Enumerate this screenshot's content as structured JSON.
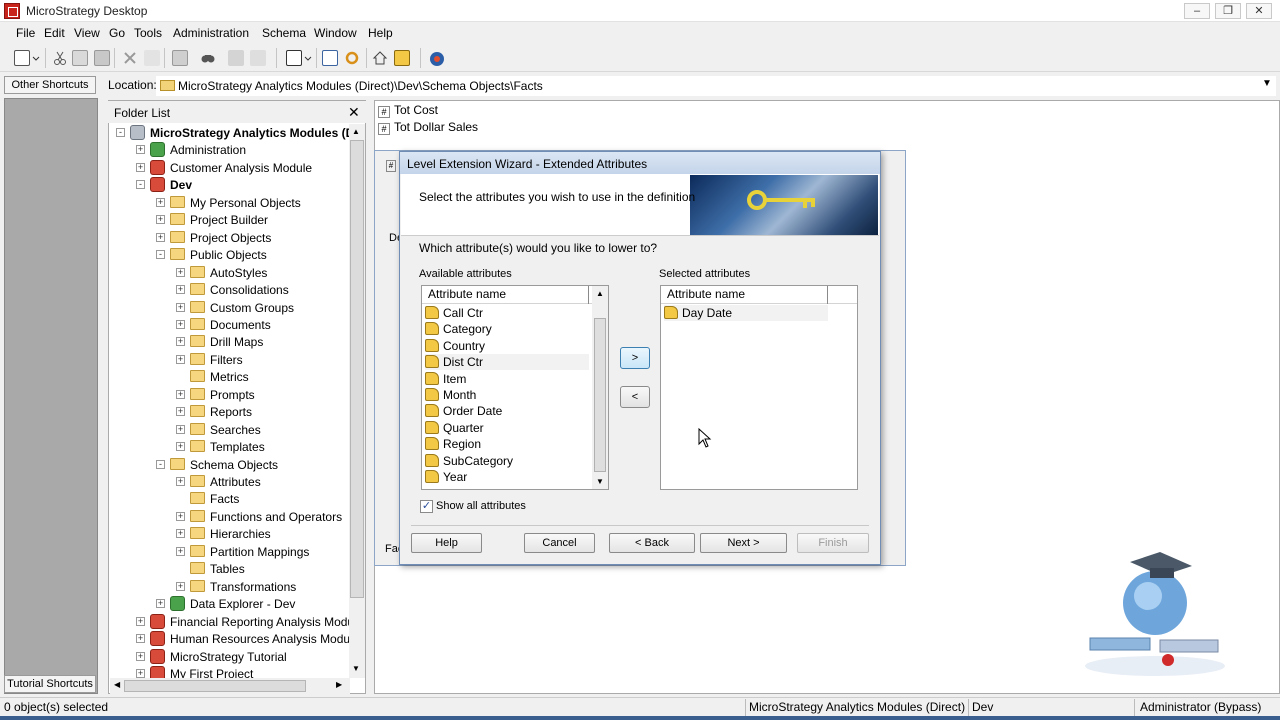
{
  "window": {
    "title": "MicroStrategy Desktop",
    "minimize": "–",
    "restore": "❐",
    "close": "✕"
  },
  "menu": {
    "file": "File",
    "edit": "Edit",
    "view": "View",
    "go": "Go",
    "tools": "Tools",
    "administration": "Administration",
    "schema": "Schema",
    "window": "Window",
    "help": "Help"
  },
  "shortcuts": {
    "other": "Other Shortcuts",
    "tutorial": "Tutorial Shortcuts"
  },
  "location": {
    "label": "Location:",
    "path": "MicroStrategy Analytics Modules (Direct)\\Dev\\Schema Objects\\Facts"
  },
  "folder_list": {
    "title": "Folder List",
    "close": "✕",
    "nodes": [
      {
        "label": "MicroStrategy Analytics Modules (D",
        "bold": true
      },
      {
        "label": "Administration"
      },
      {
        "label": "Customer Analysis Module"
      },
      {
        "label": "Dev",
        "bold": true
      },
      {
        "label": "My Personal Objects"
      },
      {
        "label": "Project Builder"
      },
      {
        "label": "Project Objects"
      },
      {
        "label": "Public Objects"
      },
      {
        "label": "AutoStyles"
      },
      {
        "label": "Consolidations"
      },
      {
        "label": "Custom Groups"
      },
      {
        "label": "Documents"
      },
      {
        "label": "Drill Maps"
      },
      {
        "label": "Filters"
      },
      {
        "label": "Metrics"
      },
      {
        "label": "Prompts"
      },
      {
        "label": "Reports"
      },
      {
        "label": "Searches"
      },
      {
        "label": "Templates"
      },
      {
        "label": "Schema Objects"
      },
      {
        "label": "Attributes"
      },
      {
        "label": "Facts"
      },
      {
        "label": "Functions and Operators"
      },
      {
        "label": "Hierarchies"
      },
      {
        "label": "Partition Mappings"
      },
      {
        "label": "Tables"
      },
      {
        "label": "Transformations"
      },
      {
        "label": "Data Explorer - Dev"
      },
      {
        "label": "Financial Reporting Analysis Modu"
      },
      {
        "label": "Human Resources Analysis Modu"
      },
      {
        "label": "MicroStrategy Tutorial"
      },
      {
        "label": "My First Project"
      }
    ]
  },
  "content": {
    "rows": [
      "Tot Cost",
      "Tot Dollar Sales"
    ],
    "bg_fragments": {
      "de": "De",
      "fac": "Fac"
    }
  },
  "wizard": {
    "title": "Level Extension Wizard - Extended Attributes",
    "instruction": "Select the attributes you wish to use in the definition",
    "question": "Which attribute(s) would you like to lower to?",
    "available_label": "Available attributes",
    "selected_label": "Selected attributes",
    "column_header": "Attribute name",
    "available": [
      "Call Ctr",
      "Category",
      "Country",
      "Dist Ctr",
      "Item",
      "Month",
      "Order Date",
      "Quarter",
      "Region",
      "SubCategory",
      "Year"
    ],
    "selected": [
      "Day Date"
    ],
    "add_label": ">",
    "remove_label": "<",
    "show_all_label": "Show all attributes",
    "show_all_checked": "✓",
    "buttons": {
      "help": "Help",
      "cancel": "Cancel",
      "back": "< Back",
      "next": "Next >",
      "finish": "Finish"
    }
  },
  "status": {
    "selected": "0 object(s) selected",
    "project": "MicroStrategy Analytics Modules (Direct)",
    "folder": "Dev",
    "user": "Administrator (Bypass)"
  },
  "colors": {
    "wizard_border": "#6f8db5",
    "folder_yellow": "#f6d67e",
    "attribute_yellow": "#f2c844"
  }
}
